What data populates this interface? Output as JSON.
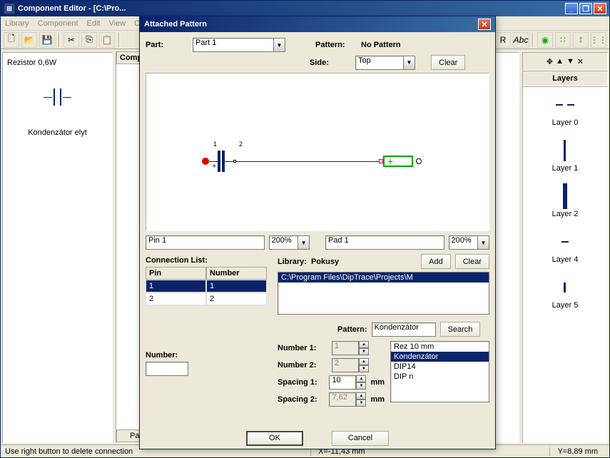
{
  "window": {
    "title": "Component Editor - [C:\\Pro...",
    "menubar": [
      "Library",
      "Component",
      "Edit",
      "View",
      "O"
    ],
    "win_buttons": {
      "min": "_",
      "max": "❐",
      "close": "✕"
    }
  },
  "left": {
    "lib_title": "Rezistor 0,6W",
    "comp_label": "Kondenzátor elyt"
  },
  "center": {
    "tab_header_fragment": "Compo",
    "bottom_tab": "Part"
  },
  "right": {
    "panel_title": "Layers",
    "layers": [
      "Layer 0",
      "Layer 1",
      "Layer 2",
      "Layer 4",
      "Layer 5"
    ],
    "nav_close": "✕"
  },
  "status": {
    "hint": "Use right button to delete connection",
    "x": "X=-11,43 mm",
    "y": "Y=8,89 mm"
  },
  "dialog": {
    "title": "Attached Pattern",
    "part_label": "Part:",
    "part_value": "Part 1",
    "pattern_label": "Pattern:",
    "pattern_value": "No Pattern",
    "side_label": "Side:",
    "side_value": "Top",
    "clear_btn": "Clear",
    "pin_field": "Pin 1",
    "pin_zoom": "200%",
    "pad_field": "Pad 1",
    "pad_zoom": "200%",
    "conn_title": "Connection List:",
    "conn_headers": [
      "Pin",
      "Number"
    ],
    "conn_rows": [
      [
        "1",
        "1"
      ],
      [
        "2",
        "2"
      ]
    ],
    "number_label": "Number:",
    "number_value": "",
    "lib_label": "Library:",
    "lib_name": "Pokusy",
    "add_btn": "Add",
    "clear_btn2": "Clear",
    "lib_path": "C:\\Program Files\\DipTrace\\Projects\\M",
    "pattern_label2": "Pattern:",
    "pattern_search_value": "Kondenzátor",
    "search_btn": "Search",
    "num1_label": "Number 1:",
    "num1_value": "1",
    "num2_label": "Number 2:",
    "num2_value": "2",
    "sp1_label": "Spacing 1:",
    "sp1_value": "10",
    "sp2_label": "Spacing 2:",
    "sp2_value": "7,62",
    "mm": "mm",
    "pattern_list": [
      "Rez 10 mm",
      "Kondenzátor",
      "DIP14",
      "DIP n"
    ],
    "ok": "OK",
    "cancel": "Cancel"
  }
}
